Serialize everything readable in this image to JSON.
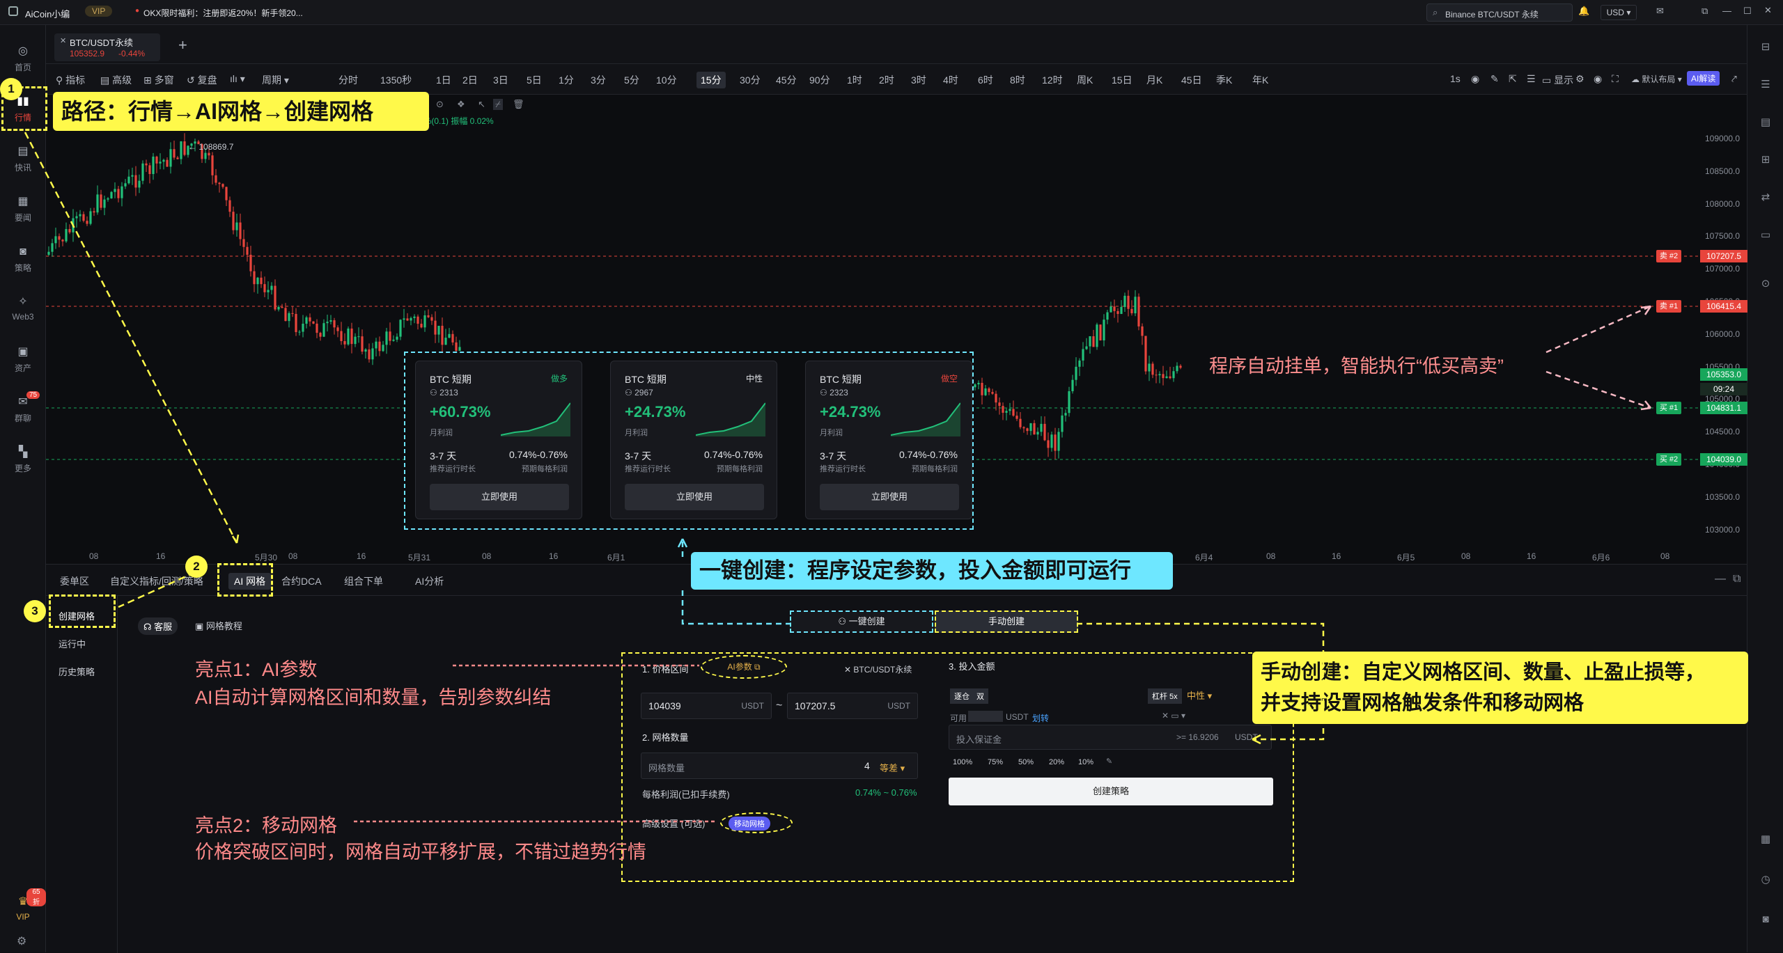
{
  "topbar": {
    "app_name": "AiCoin小编",
    "vip": "VIP",
    "promo": "OKX限时福利：注册即返20%！新手领20...",
    "search_value": "Binance BTC/USDT 永续",
    "currency": "USD"
  },
  "sidebar": {
    "items": [
      {
        "label": "首页",
        "icon": "home-icon"
      },
      {
        "label": "行情",
        "icon": "chart-bars-icon"
      },
      {
        "label": "快讯",
        "icon": "news-icon"
      },
      {
        "label": "要闻",
        "icon": "document-icon"
      },
      {
        "label": "策略",
        "icon": "robot-icon"
      },
      {
        "label": "Web3",
        "icon": "web3-icon"
      },
      {
        "label": "资产",
        "icon": "wallet-icon"
      },
      {
        "label": "群聊",
        "icon": "chat-icon",
        "badge": "75"
      },
      {
        "label": "更多",
        "icon": "grid-icon"
      }
    ],
    "vip_label": "VIP",
    "vip_badge": "65折"
  },
  "tab": {
    "symbol": "BTC/USDT永续",
    "price": "105352.9",
    "change": "-0.44%",
    "add": "+"
  },
  "toolbar": {
    "left": [
      "指标",
      "高级",
      "多窗",
      "复盘"
    ],
    "period_label": "周期",
    "timeframes": [
      "分时",
      "1350秒",
      "1日",
      "2日",
      "3日",
      "5日",
      "1分",
      "3分",
      "5分",
      "10分",
      "15分",
      "30分",
      "45分",
      "90分",
      "1时",
      "2时",
      "3时",
      "4时",
      "6时",
      "8时",
      "12时",
      "周K",
      "15日",
      "月K",
      "45日",
      "季K",
      "年K"
    ],
    "active_timeframe": "15分",
    "right": {
      "interval": "1s",
      "display": "显示",
      "layout": "默认布局",
      "ai": "AI解读"
    }
  },
  "chart": {
    "indicator_line": "0%(0.1) 振幅 0.02%",
    "high_label": "108869.7",
    "y_ticks": [
      "109000.0",
      "108500.0",
      "108000.0",
      "107500.0",
      "107000.0",
      "106500.0",
      "106000.0",
      "105500.0",
      "105000.0",
      "104500.0",
      "104000.0",
      "103500.0",
      "103000.0"
    ],
    "x_ticks": [
      "08",
      "16",
      "5月30",
      "08",
      "16",
      "5月31",
      "08",
      "16",
      "6月1",
      "6月4",
      "08",
      "16",
      "6月5",
      "08",
      "16",
      "6月6",
      "08"
    ],
    "price_tags": {
      "sell2": "107207.5",
      "sell1": "106415.4",
      "last": "105353.0",
      "countdown": "09:24",
      "buy1": "104831.1",
      "buy2": "104039.0"
    },
    "order_labels": {
      "sell2": "卖 #2",
      "sell1": "卖 #1",
      "buy1": "买 #1",
      "buy2": "买 #2"
    },
    "annotation": "程序自动挂单，智能执行“低买高卖”"
  },
  "cards": [
    {
      "title": "BTC 短期",
      "tag": "做多",
      "users": "2313",
      "profit": "+60.73%",
      "profit_label": "月利润",
      "duration": "3-7 天",
      "duration_label": "推荐运行时长",
      "range": "0.74%-0.76%",
      "range_label": "预期每格利润",
      "button": "立即使用"
    },
    {
      "title": "BTC 短期",
      "tag": "中性",
      "users": "2967",
      "profit": "+24.73%",
      "profit_label": "月利润",
      "duration": "3-7 天",
      "duration_label": "推荐运行时长",
      "range": "0.74%-0.76%",
      "range_label": "预期每格利润",
      "button": "立即使用"
    },
    {
      "title": "BTC 短期",
      "tag": "做空",
      "users": "2323",
      "profit": "+24.73%",
      "profit_label": "月利润",
      "duration": "3-7 天",
      "duration_label": "推荐运行时长",
      "range": "0.74%-0.76%",
      "range_label": "预期每格利润",
      "button": "立即使用"
    }
  ],
  "callouts": {
    "path": "路径：行情→AI网格→创建网格",
    "one_click": "一键创建：程序设定参数，投入金额即可运行",
    "manual_1": "手动创建：自定义网格区间、数量、止盈止损等，",
    "manual_2": "并支持设置网格触发条件和移动网格",
    "hl1_title": "亮点1：AI参数",
    "hl1_body": "AI自动计算网格区间和数量，告别参数纠结",
    "hl2_title": "亮点2：移动网格",
    "hl2_body": "价格突破区间时，网格自动平移扩展，不错过趋势行情",
    "n1": "1",
    "n2": "2",
    "n3": "3"
  },
  "bottom": {
    "tabs": [
      "委单区",
      "自定义指标/回测/策略",
      "AI 网格",
      "合约DCA",
      "组合下单",
      "AI分析"
    ],
    "active_tab": "AI 网格",
    "left_menu": [
      "创建网格",
      "运行中",
      "历史策略"
    ],
    "support": "客服",
    "tutorial": "网格教程",
    "mode_one_click": "一键创建",
    "mode_manual": "手动创建",
    "form": {
      "s1_title": "1. 价格区间",
      "ai_param": "AI参数",
      "pair": "BTC/USDT永续",
      "low": "104039",
      "high": "107207.5",
      "unit": "USDT",
      "tilde": "~",
      "s2_title": "2. 网格数量",
      "grid_label": "网格数量",
      "grid_value": "4",
      "grid_mode": "等差",
      "profit_label": "每格利润(已扣手续费)",
      "profit_value": "0.74% ~ 0.76%",
      "advanced": "高级设置 (可选)",
      "moving_grid": "移动网格",
      "s3_title": "3. 投入金额",
      "margin_modes": [
        "逐仓",
        "双"
      ],
      "leverage": "杠杆 5x",
      "direction": "中性",
      "avail_label": "可用",
      "avail_unit": "USDT",
      "transfer": "划转",
      "margin_placeholder": "投入保证金",
      "margin_min": ">= 16.9206",
      "pcts": [
        "100%",
        "75%",
        "50%",
        "20%",
        "10%"
      ],
      "create": "创建策略"
    }
  },
  "colors": {
    "up": "#22c07a",
    "down": "#e8453c",
    "accent": "#fff94a",
    "cyan": "#6ee7ff"
  }
}
